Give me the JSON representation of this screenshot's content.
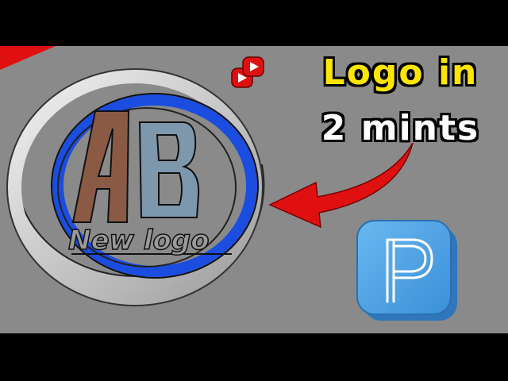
{
  "headline": {
    "line1": "Logo in",
    "line2": "2 mints"
  },
  "logo": {
    "letters": "AB",
    "tagline": "New logo"
  },
  "icons": {
    "top": "youtube-double-play-icon",
    "bottom": "pixellab-p-app-icon",
    "arrow": "curved-red-arrow"
  },
  "colors": {
    "background": "#8a8a8a",
    "letterbox": "#000000",
    "headline1": "#ffe600",
    "headline2": "#ffffff",
    "ringBlue": "#1a4de0",
    "ringSilver": "#d8d8d8",
    "letterA": "#8a5a44",
    "letterB": "#7d97ad",
    "arrow": "#e01010",
    "appIcon": "#4aa3e6"
  }
}
